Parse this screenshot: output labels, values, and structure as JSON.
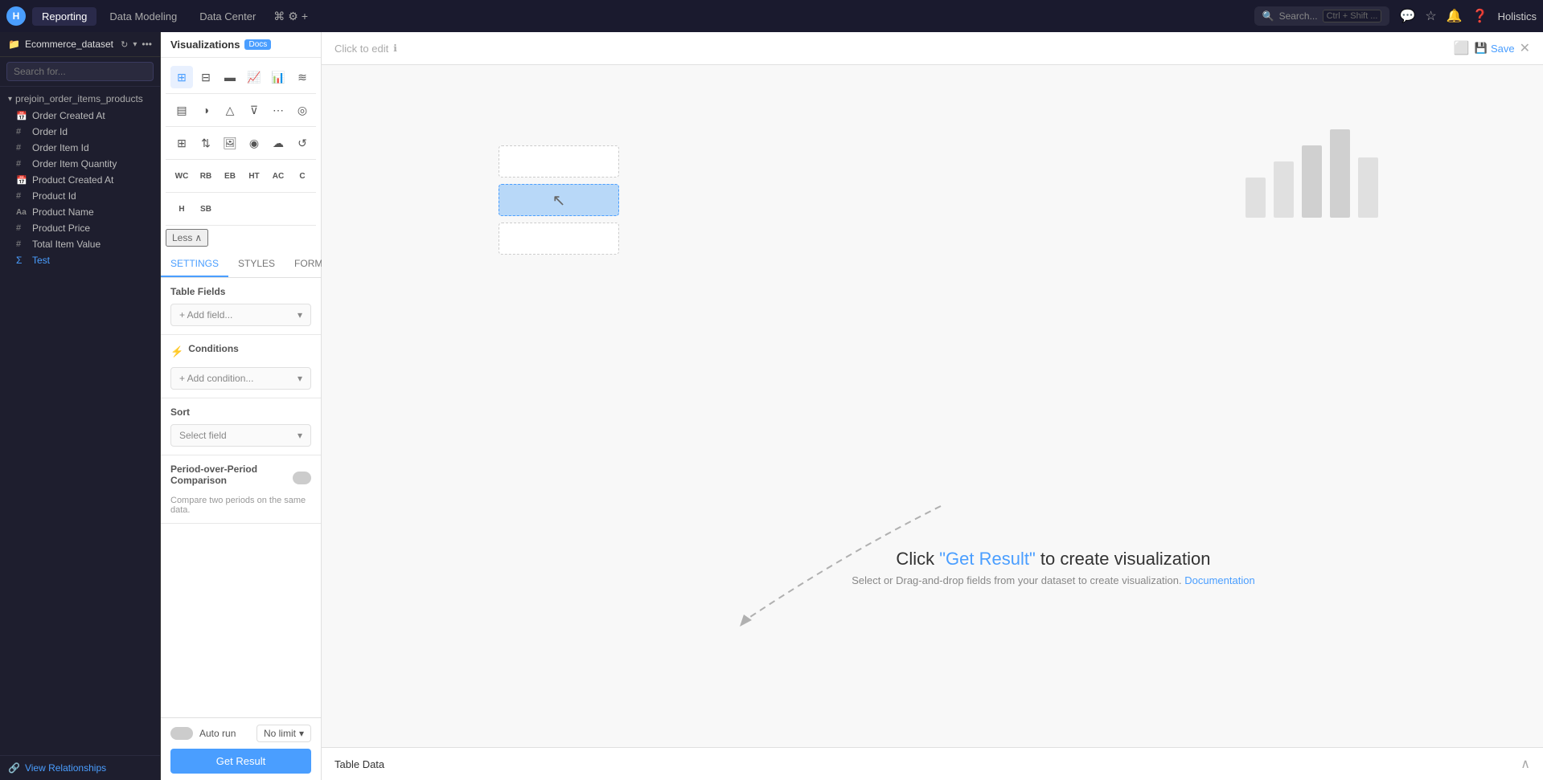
{
  "app": {
    "logo": "H",
    "tabs": [
      {
        "label": "Reporting",
        "active": true
      },
      {
        "label": "Data Modeling",
        "active": false
      },
      {
        "label": "Data Center",
        "active": false
      }
    ],
    "search_placeholder": "Search...",
    "search_shortcut": "Ctrl + Shift ...",
    "user": "Holistics"
  },
  "sidebar": {
    "dataset_name": "Ecommerce_dataset",
    "search_placeholder": "Search for...",
    "group": {
      "name": "prejoin_order_items_products",
      "items": [
        {
          "label": "Order Created At",
          "icon": "calendar",
          "type": "date"
        },
        {
          "label": "Order Id",
          "icon": "hash",
          "type": "number"
        },
        {
          "label": "Order Item Id",
          "icon": "hash",
          "type": "number"
        },
        {
          "label": "Order Item Quantity",
          "icon": "hash",
          "type": "number"
        },
        {
          "label": "Product Created At",
          "icon": "calendar",
          "type": "date"
        },
        {
          "label": "Product Id",
          "icon": "hash",
          "type": "number"
        },
        {
          "label": "Product Name",
          "icon": "text",
          "type": "text"
        },
        {
          "label": "Product Price",
          "icon": "hash",
          "type": "number"
        },
        {
          "label": "Total Item Value",
          "icon": "hash",
          "type": "number"
        },
        {
          "label": "Test",
          "icon": "sigma",
          "type": "formula"
        }
      ]
    },
    "footer": {
      "view_relationships": "View Relationships"
    }
  },
  "visualizations": {
    "title": "Visualizations",
    "docs_label": "Docs",
    "icons_row1": [
      "table",
      "pivot",
      "bar",
      "line",
      "column",
      "area"
    ],
    "icons_row2": [
      "bar-stacked",
      "pie",
      "triangle",
      "funnel",
      "scatter",
      "donut"
    ],
    "icons_row3": [
      "matrix",
      "waterfall",
      "image",
      "radial",
      "cloud",
      "arc"
    ],
    "text_buttons": [
      "WC",
      "RB",
      "EB",
      "HT",
      "AC",
      "C",
      "H",
      "SB"
    ],
    "less_label": "Less"
  },
  "settings": {
    "tabs": [
      "SETTINGS",
      "STYLES",
      "FORMAT"
    ],
    "active_tab": "SETTINGS",
    "table_fields": {
      "title": "Table Fields",
      "add_field_placeholder": "+ Add field..."
    },
    "conditions": {
      "title": "Conditions",
      "add_condition_placeholder": "+ Add condition..."
    },
    "sort": {
      "title": "Sort",
      "select_field_placeholder": "Select field"
    },
    "pop_comparison": {
      "title": "Period-over-Period Comparison",
      "description": "Compare two periods on the same data."
    }
  },
  "bottom_bar": {
    "auto_run_label": "Auto run",
    "no_limit_label": "No limit",
    "get_result_label": "Get Result"
  },
  "content": {
    "click_to_edit": "Click to edit",
    "save_label": "Save",
    "main_message_line1": "Click ",
    "main_message_highlight": "\"Get Result\"",
    "main_message_line1_end": " to create visualization",
    "main_message_line2": "Select or Drag-and-drop fields from your dataset to create visualization.",
    "documentation_link": "Documentation"
  },
  "table_data": {
    "title": "Table Data"
  }
}
